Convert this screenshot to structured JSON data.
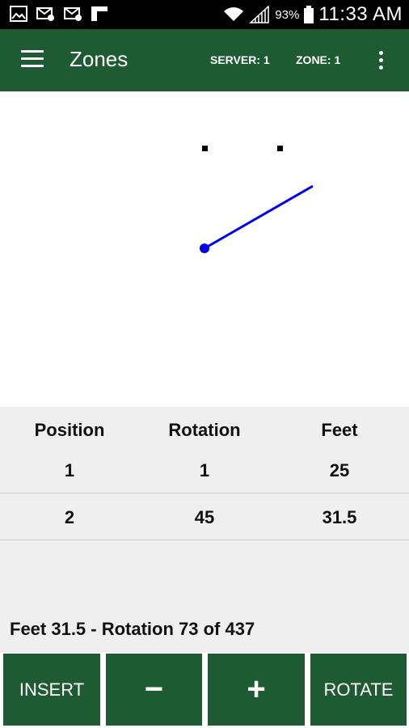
{
  "status_bar": {
    "battery_percent": "93%",
    "time": "11:33 AM",
    "icons": [
      "photo-icon",
      "mail-icon",
      "mail-icon",
      "flipboard-icon",
      "wifi-icon",
      "signal-icon",
      "battery-icon"
    ]
  },
  "app_bar": {
    "title": "Zones",
    "server": "SERVER: 1",
    "zone": "ZONE: 1",
    "color": "#1e5a32"
  },
  "canvas": {
    "line_color": "#0000ee"
  },
  "table": {
    "headers": [
      "Position",
      "Rotation",
      "Feet"
    ],
    "rows": [
      [
        "1",
        "1",
        "25"
      ],
      [
        "2",
        "45",
        "31.5"
      ]
    ]
  },
  "status": "Feet 31.5 - Rotation 73 of 437",
  "buttons": {
    "insert": "INSERT",
    "minus": "−",
    "plus": "+",
    "rotate": "ROTATE"
  }
}
